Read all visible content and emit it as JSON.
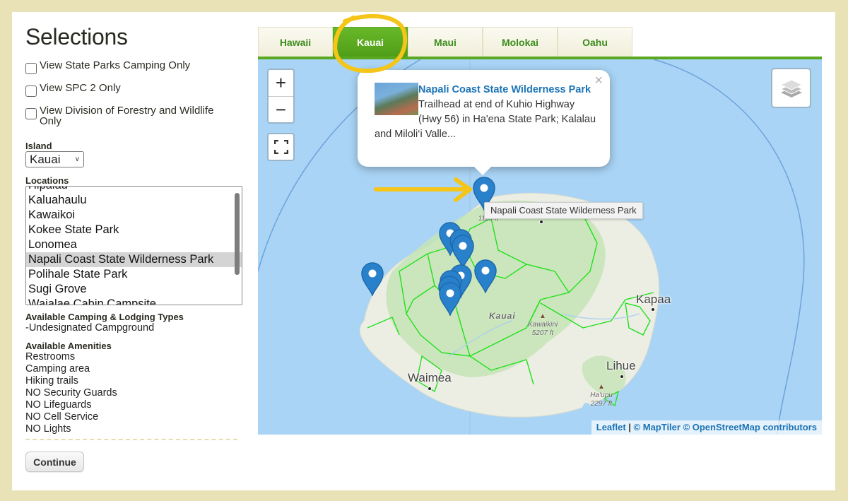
{
  "sidebar": {
    "title": "Selections",
    "checkboxes": [
      {
        "label": "View State Parks Camping Only",
        "checked": false
      },
      {
        "label": "View SPC 2 Only",
        "checked": false
      },
      {
        "label": "View Division of Forestry and Wildlife Only",
        "checked": false
      }
    ],
    "island_label": "Island",
    "island_value": "Kauai",
    "locations_label": "Locations",
    "locations": [
      "Hipalau",
      "Kaluahaulu",
      "Kawaikoi",
      "Kokee State Park",
      "Lonomea",
      "Napali Coast State Wilderness Park",
      "Polihale State Park",
      "Sugi Grove",
      "Waialae Cabin Campsite"
    ],
    "selected_location": "Napali Coast State Wilderness Park",
    "camping_types_label": "Available Camping & Lodging Types",
    "camping_types": [
      "-Undesignated Campground"
    ],
    "amenities_label": "Available Amenities",
    "amenities": [
      "Restrooms",
      "Camping area",
      "Hiking trails",
      "NO Security Guards",
      "NO Lifeguards",
      "NO Cell Service",
      "NO Lights"
    ],
    "continue_label": "Continue"
  },
  "tabs": [
    {
      "label": "Hawaii",
      "active": false
    },
    {
      "label": "Kauai",
      "active": true
    },
    {
      "label": "Maui",
      "active": false
    },
    {
      "label": "Molokai",
      "active": false
    },
    {
      "label": "Oahu",
      "active": false
    }
  ],
  "map": {
    "zoom_in": "+",
    "zoom_out": "−",
    "fullscreen_icon": "fullscreen-icon",
    "layers_icon": "layers-icon",
    "popup": {
      "title": "Napali Coast State Wilderness Park",
      "description": "Trailhead at end of Kuhio Highway (Hwy 56) in Ha'ena State Park; Kalalau and Miloli‘i Valle...",
      "close": "×"
    },
    "tooltip": "Napali Coast State Wilderness Park",
    "places": {
      "kapaa": "Kapaa",
      "lihue": "Lihue",
      "waimea": "Waimea",
      "kauai": "Kauai",
      "kawaikini": "Kawaikini",
      "kawaikini_elev": "5207 ft",
      "haupu": "Ha‘upu",
      "haupu_elev": "2297 ft",
      "north_peak_elev": "1119 ft"
    },
    "attribution": {
      "leaflet": "Leaflet",
      "sep": " | ",
      "rest": "© MapTiler © OpenStreetMap contributors"
    },
    "colors": {
      "water": "#a9d4f5",
      "land": "#eceee4",
      "forest": "#c6e4b5",
      "trail_outline": "#22e01e",
      "marker": "#2a81cb",
      "accent_tab": "#5aa81f",
      "annotation": "#f5c518"
    }
  }
}
